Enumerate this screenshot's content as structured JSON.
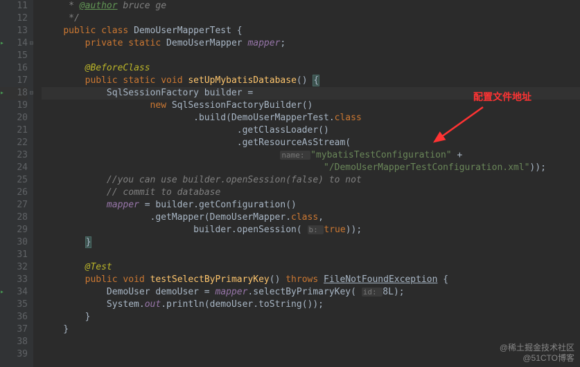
{
  "gutter": {
    "start": 11,
    "end": 39,
    "highlighted": 18,
    "runIcons": [
      14,
      18,
      34
    ],
    "foldIcons": [
      14,
      18
    ]
  },
  "lines": {
    "l11": {
      "indent": "     ",
      "comment_prefix": "* ",
      "author_tag": "@author",
      "author_name": " bruce ge"
    },
    "l12": {
      "indent": "     ",
      "comment": "*/"
    },
    "l13": {
      "indent": "    ",
      "kw1": "public ",
      "kw2": "class ",
      "name": "DemoUserMapperTest ",
      "brace": "{"
    },
    "l14": {
      "indent": "        ",
      "kw1": "private ",
      "kw2": "static ",
      "type": "DemoUserMapper ",
      "field": "mapper",
      "semi": ";"
    },
    "l15": "",
    "l16": {
      "indent": "        ",
      "anno": "@BeforeClass"
    },
    "l17": {
      "indent": "        ",
      "kw1": "public ",
      "kw2": "static ",
      "kw3": "void ",
      "method": "setUpMybatisDatabase",
      "parens": "() ",
      "brace": "{"
    },
    "l18": {
      "indent": "            ",
      "type": "SqlSessionFactory ",
      "var": "builder ="
    },
    "l19": {
      "indent": "                    ",
      "kw": "new ",
      "type": "SqlSessionFactoryBuilder",
      "rest": "()"
    },
    "l20": {
      "indent": "                            ",
      "dot": ".build(DemoUserMapperTest.",
      "kw": "class"
    },
    "l21": {
      "indent": "                                    ",
      "rest": ".getClassLoader()"
    },
    "l22": {
      "indent": "                                    ",
      "rest": ".getResourceAsStream("
    },
    "l23": {
      "indent": "                                            ",
      "hint": "name: ",
      "str": "\"mybatisTestConfiguration\"",
      "plus": " +"
    },
    "l24": {
      "indent": "                                                    ",
      "str": "\"/DemoUserMapperTestConfiguration.xml\"",
      "rest": "));"
    },
    "l25": {
      "indent": "            ",
      "comment": "//you can use builder.openSession(false) to not"
    },
    "l26": {
      "indent": "            ",
      "comment": "// commit to database"
    },
    "l27": {
      "indent": "            ",
      "field": "mapper",
      "rest": " = builder.getConfiguration()"
    },
    "l28": {
      "indent": "                    ",
      "rest": ".getMapper(DemoUserMapper.",
      "kw": "class",
      "comma": ","
    },
    "l29": {
      "indent": "                            ",
      "pre": "builder.openSession( ",
      "hint": "b: ",
      "kw": "true",
      "rest": "));"
    },
    "l30": {
      "indent": "        ",
      "brace": "}"
    },
    "l31": "",
    "l32": {
      "indent": "        ",
      "anno": "@Test"
    },
    "l33": {
      "indent": "        ",
      "kw1": "public ",
      "kw2": "void ",
      "method": "testSelectByPrimaryKey",
      "parens": "() ",
      "kw3": "throws ",
      "exc": "FileNotFoundException",
      "rest": " {"
    },
    "l34": {
      "indent": "            ",
      "type": "DemoUser ",
      "var": "demoUser = ",
      "field": "mapper",
      "rest": ".selectByPrimaryKey( ",
      "hint": "id: ",
      "val": "8L",
      "end": ");"
    },
    "l35": {
      "indent": "            ",
      "pre": "System.",
      "field": "out",
      "rest": ".println(demoUser.toString());"
    },
    "l36": {
      "indent": "        ",
      "brace": "}"
    },
    "l37": {
      "indent": "    ",
      "brace": "}"
    },
    "l38": ""
  },
  "annotation": {
    "label": "配置文件地址"
  },
  "watermark": {
    "line1": "@稀土掘金技术社区",
    "line2": "@51CTO博客"
  }
}
